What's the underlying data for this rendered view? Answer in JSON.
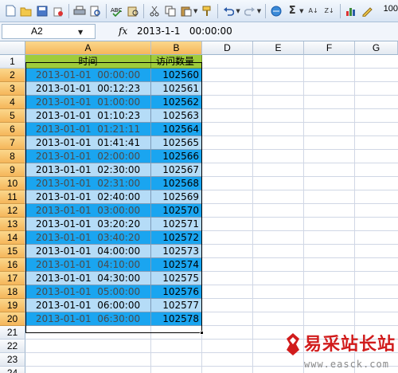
{
  "toolbar": {
    "icons": [
      "new-icon",
      "open-icon",
      "save-icon",
      "permission-icon",
      "print-icon",
      "print-preview-icon",
      "spelling-icon",
      "research-icon",
      "cut-icon",
      "copy-icon",
      "paste-icon",
      "format-painter-icon",
      "undo-icon",
      "redo-icon",
      "hyperlink-icon",
      "autosum-icon",
      "sort-ascending-icon",
      "sort-descending-icon",
      "chart-wizard-icon",
      "drawing-icon"
    ],
    "zoom": "100"
  },
  "formula_bar": {
    "name_box": "A2",
    "fx_label": "fx",
    "formula": "2013-1-1   00:00:00"
  },
  "columns": [
    "A",
    "B",
    "D",
    "E",
    "F",
    "G"
  ],
  "rows": [
    "1",
    "2",
    "3",
    "4",
    "5",
    "6",
    "7",
    "8",
    "9",
    "10",
    "11",
    "12",
    "13",
    "14",
    "15",
    "16",
    "17",
    "18",
    "19",
    "20",
    "21",
    "22",
    "23",
    "24"
  ],
  "sheet": {
    "headers": {
      "time": "时间",
      "visits": "访问数量"
    },
    "records": [
      {
        "time": "2013-01-01  00:00:00",
        "visits": "102560"
      },
      {
        "time": "2013-01-01  00:12:23",
        "visits": "102561"
      },
      {
        "time": "2013-01-01  01:00:00",
        "visits": "102562"
      },
      {
        "time": "2013-01-01  01:10:23",
        "visits": "102563"
      },
      {
        "time": "2013-01-01  01:21:11",
        "visits": "102564"
      },
      {
        "time": "2013-01-01  01:41:41",
        "visits": "102565"
      },
      {
        "time": "2013-01-01  02:00:00",
        "visits": "102566"
      },
      {
        "time": "2013-01-01  02:30:00",
        "visits": "102567"
      },
      {
        "time": "2013-01-01  02:31:00",
        "visits": "102568"
      },
      {
        "time": "2013-01-01  02:40:00",
        "visits": "102569"
      },
      {
        "time": "2013-01-01  03:00:00",
        "visits": "102570"
      },
      {
        "time": "2013-01-01  03:20:20",
        "visits": "102571"
      },
      {
        "time": "2013-01-01  03:40:20",
        "visits": "102572"
      },
      {
        "time": "2013-01-01  04:00:00",
        "visits": "102573"
      },
      {
        "time": "2013-01-01  04:10:00",
        "visits": "102574"
      },
      {
        "time": "2013-01-01  04:30:00",
        "visits": "102575"
      },
      {
        "time": "2013-01-01  05:00:00",
        "visits": "102576"
      },
      {
        "time": "2013-01-01  06:00:00",
        "visits": "102577"
      },
      {
        "time": "2013-01-01  06:30:00",
        "visits": "102578"
      }
    ]
  },
  "colors": {
    "header_fill": "#9fcc3b",
    "row_dark": "#1aa5f0",
    "row_light": "#b5dcf7",
    "selected_header": "#f5b65a"
  },
  "watermark": {
    "title": "易采站长站",
    "url": "www.easck.com"
  }
}
